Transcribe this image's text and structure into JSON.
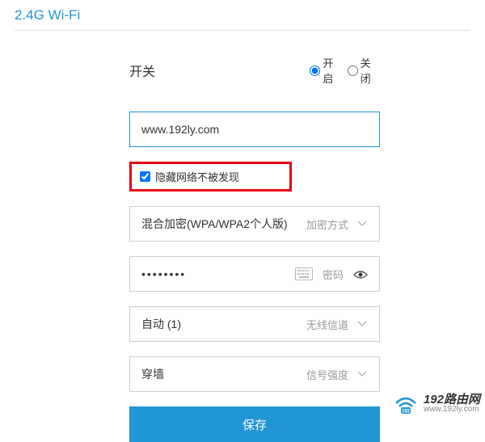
{
  "header": {
    "title": "2.4G Wi-Fi"
  },
  "switch": {
    "label": "开关",
    "on_label": "开启",
    "off_label": "关闭",
    "value": "on"
  },
  "ssid": {
    "value": "www.192ly.com"
  },
  "hide_network": {
    "label": "隐藏网络不被发现",
    "checked": true
  },
  "encryption": {
    "value": "混合加密(WPA/WPA2个人版)",
    "label": "加密方式"
  },
  "password": {
    "value": "••••••••",
    "label": "密码"
  },
  "channel": {
    "value": "自动 (1)",
    "label": "无线信道"
  },
  "signal": {
    "value": "穿墙",
    "label": "信号强度"
  },
  "save": {
    "label": "保存"
  },
  "watermark": {
    "brand": "192路由网",
    "url": "www.192ly.com"
  }
}
